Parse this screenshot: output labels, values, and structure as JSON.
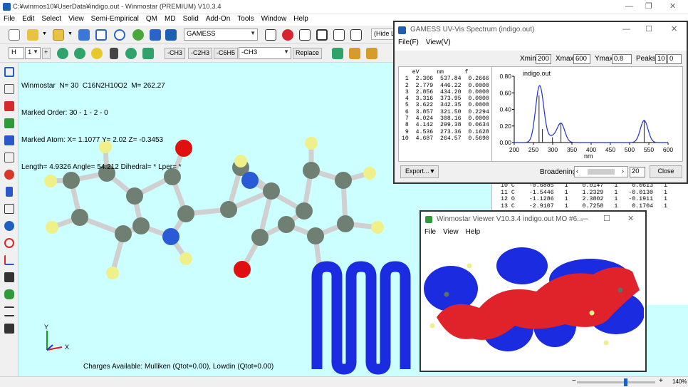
{
  "main_window": {
    "title": "C:¥winmos10¥UserData¥indigo.out - Winmostar (PREMIUM) V10.3.4",
    "menu": [
      "File",
      "Edit",
      "Select",
      "View",
      "Semi-Empirical",
      "QM",
      "MD",
      "Solid",
      "Add-On",
      "Tools",
      "Window",
      "Help"
    ],
    "solver_combo": "GAMESS",
    "hide_label": "(Hide L",
    "element_combo": "H",
    "count_combo": "1",
    "plus": "+",
    "substituent_buttons": [
      "-CH3",
      "-C2H3",
      "-C6H5"
    ],
    "substituent_combo": "-CH3",
    "replace_button": "Replace",
    "info_lines": [
      "Winmostar  N= 30  C16N2H10O2  M= 262.27",
      "Marked Order: 30 - 1 - 2 - 0",
      "Marked Atom: X= 1.1077 Y= 2.02 Z= -0.3453",
      "Length= 4.9326 Angle= 54.212 Dihedral= * Lper= *"
    ],
    "charges_text": "Charges Available: Mulliken (Qtot=0.00), Lowdin (Qtot=0.00)",
    "axis_x": "X",
    "axis_y": "Y",
    "zoom": "140%"
  },
  "spectrum_window": {
    "title": "GAMESS UV-Vis Spectrum (indigo.out)",
    "menu": [
      "File(F)",
      "View(V)"
    ],
    "xmin_label": "Xmin",
    "xmin": "200",
    "xmax_label": "Xmax",
    "xmax": "600",
    "ymax_label": "Ymax",
    "ymax": "0.8",
    "peaks_label": "Peaks",
    "peaks_a": "10",
    "peaks_b": "0",
    "table_header": "   eV     nm      f",
    "table_rows": [
      " 1  2.306  537.84  0.2666",
      " 2  2.779  446.22  0.0000",
      " 3  2.856  434.20  0.0000",
      " 4  3.316  373.95  0.0000",
      " 5  3.622  342.35  0.0000",
      " 6  3.857  321.50  0.2294",
      " 7  4.024  308.16  0.0000",
      " 8  4.142  299.38  0.0634",
      " 9  4.536  273.36  0.1628",
      "10  4.687  264.57  0.5690"
    ],
    "export_button": "Export...",
    "broadening_label": "Broadening",
    "broadening_value": "20",
    "close_button": "Close"
  },
  "chart_data": {
    "type": "line",
    "title": "indigo.out",
    "xlabel": "nm",
    "ylabel": "",
    "xlim": [
      200,
      600
    ],
    "ylim": [
      0,
      0.8
    ],
    "x_ticks": [
      200,
      250,
      300,
      350,
      400,
      450,
      500,
      550,
      600
    ],
    "y_ticks": [
      "0.00",
      "0.20",
      "0.40",
      "0.60",
      "0.80"
    ],
    "y_tick_values": [
      0,
      0.2,
      0.4,
      0.6,
      0.8
    ],
    "sticks": [
      {
        "nm": 537.84,
        "f": 0.2666
      },
      {
        "nm": 321.5,
        "f": 0.2294
      },
      {
        "nm": 299.38,
        "f": 0.0634
      },
      {
        "nm": 273.36,
        "f": 0.1628
      },
      {
        "nm": 264.57,
        "f": 0.569
      }
    ],
    "broadening": 20,
    "line_color": "#1f2fd8",
    "stick_color": "#222222"
  },
  "coord_rows": [
    "10 C    -0.6885   1    0.0147   1    0.0613   1",
    "11 C    -1.5446   1    1.2329   1   -0.0130   1",
    "12 O    -1.1286   1    2.3802   1   -0.1911   1",
    "13 C    -2.9107   1    0.7258   1    0.1704   1"
  ],
  "viewer_window": {
    "title": "Winmostar Viewer V10.3.4 indigo.out MO #6...",
    "menu": [
      "File",
      "View",
      "Help"
    ]
  },
  "colors": {
    "viewport_bg": "#ccffff",
    "carbon": "#6f7f72",
    "hydrogen": "#f0f08a",
    "oxygen": "#e01010",
    "nitrogen": "#2a5bd6",
    "bond": "#d0d0d0",
    "mo_positive": "#e0222a",
    "mo_negative": "#1a2be0",
    "logo_blue": "#1a2be0"
  }
}
